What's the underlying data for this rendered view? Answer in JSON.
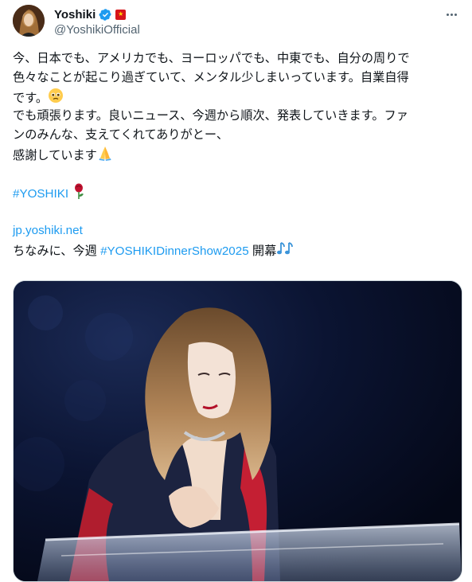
{
  "author": {
    "display_name": "Yoshiki",
    "handle": "@YoshikiOfficial",
    "verified": true,
    "avatar_icon": "avatar-photo",
    "flag_icon": "flag-icon",
    "verified_color": "#1d9bf0"
  },
  "menu": {
    "more_icon": "more-options-icon"
  },
  "tweet": {
    "lines": [
      "今、日本でも、アメリカでも、ヨーロッパでも、中東でも、自分の周りで",
      "色々なことが起こり過ぎていて、メンタル少しまいっています。自業自得",
      "です。",
      "でも頑張ります。良いニュース、今週から順次、発表していきます。ファ",
      "ンのみんな、支えてくれてありがとー、",
      "感謝しています"
    ],
    "hashtag1": "#YOSHIKI",
    "link_url": "jp.yoshiki.net",
    "last_line_prefix": "ちなみに、今週 ",
    "hashtag2": "#YOSHIKIDinnerShow2025",
    "last_line_suffix": " 開幕",
    "emoji": {
      "pleading": "pleading-face-emoji",
      "pray": "folded-hands-emoji",
      "rose": "rose-emoji",
      "notes": "musical-notes-emoji"
    },
    "link_color": "#1d9bf0"
  },
  "media": {
    "photo_icon": "performer-photo"
  }
}
